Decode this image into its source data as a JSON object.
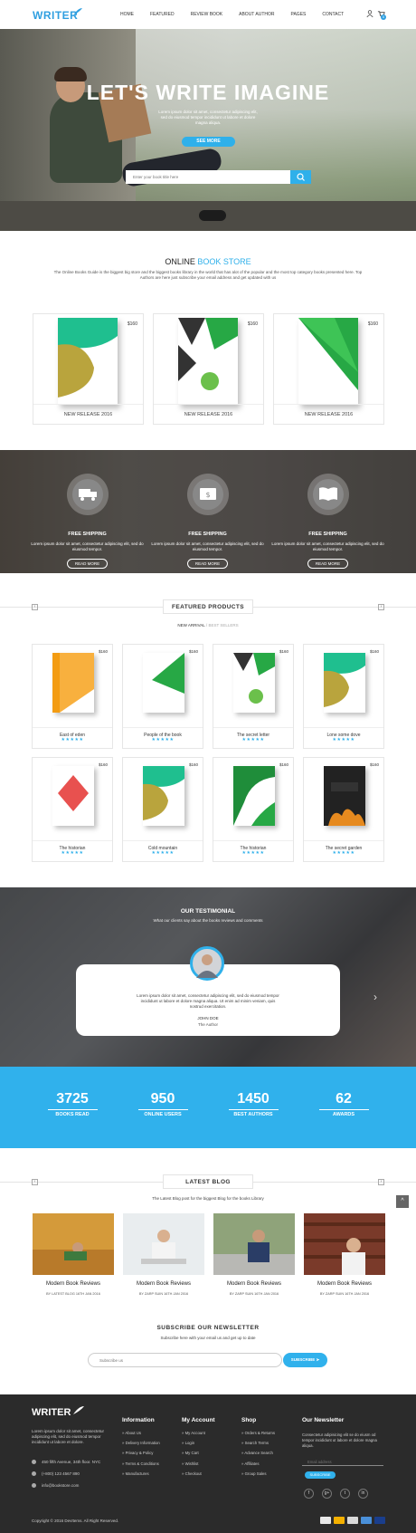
{
  "header": {
    "logo": "WRITER",
    "nav": [
      "HOME",
      "FEATURED",
      "REVIEW BOOK",
      "ABOUT AUTHOR",
      "PAGES",
      "CONTACT"
    ],
    "cart_count": "0"
  },
  "hero": {
    "title": "LET'S WRITE IMAGINE",
    "subtitle": "Lorem ipsum dolor sit amet, consectetur adipiscing elit, sed do eiusmod tempor incididunt ut labore et dolore magna aliqua.",
    "button": "SEE MORE",
    "search_placeholder": "Enter your book title here"
  },
  "online_store": {
    "title_a": "ONLINE ",
    "title_b": "BOOK STORE",
    "desc": "The Online Books Guide is the biggest big store and the biggest books library in the world that has alot of the popular and the most top category books presented here. Top Authors are here just subscribe your email address and get updated with us",
    "cards": [
      {
        "price": "$160",
        "label": "NEW RELEASE 2016"
      },
      {
        "price": "$160",
        "label": "NEW RELEASE 2016"
      },
      {
        "price": "$160",
        "label": "NEW RELEASE 2016"
      }
    ]
  },
  "features": [
    {
      "title": "FREE SHIPPING",
      "desc": "Lorem ipsum dolor sit amet, consectetur adipiscing elit, sed do eiusmod tempor.",
      "button": "READ MORE",
      "icon": "truck-icon"
    },
    {
      "title": "FREE SHIPPING",
      "desc": "Lorem ipsum dolor sit amet, consectetur adipiscing elit, sed do eiusmod tempor.",
      "button": "READ MORE",
      "icon": "money-icon"
    },
    {
      "title": "FREE SHIPPING",
      "desc": "Lorem ipsum dolor sit amet, consectetur adipiscing elit, sed do eiusmod tempor.",
      "button": "READ MORE",
      "icon": "book-icon"
    }
  ],
  "featured_products": {
    "title": "FEATURED PRODUCTS",
    "tab_active": "NEW ARRIVAL",
    "tab_sep": "/",
    "tab_other": "BEST SELLERS",
    "items": [
      {
        "price": "$160",
        "name": "East of eden",
        "stars": "★★★★★"
      },
      {
        "price": "$160",
        "name": "People of the book",
        "stars": "★★★★★"
      },
      {
        "price": "$160",
        "name": "The secret letter",
        "stars": "★★★★★"
      },
      {
        "price": "$160",
        "name": "Lone some dove",
        "stars": "★★★★★"
      },
      {
        "price": "$160",
        "name": "The historian",
        "stars": "★★★★★"
      },
      {
        "price": "$160",
        "name": "Cold mountain",
        "stars": "★★★★★"
      },
      {
        "price": "$160",
        "name": "The historian",
        "stars": "★★★★★"
      },
      {
        "price": "$160",
        "name": "The secret garden",
        "stars": "★★★★★"
      }
    ]
  },
  "testimonial": {
    "title": "OUR TESTIMONIAL",
    "subtitle": "What our clients say about the books reviews and comments",
    "text": "Lorem ipsum dolor sit amet, consectetur adipiscing elit, sed do eiusmod tempor incididunt ut labore et dolore magna aliqua. Ut enim ad minim veniam, quis nostrud exercitation.",
    "name": "JOHN DOE",
    "role": "The Author"
  },
  "stats": [
    {
      "number": "3725",
      "label": "BOOKS READ"
    },
    {
      "number": "950",
      "label": "ONLINE USERS"
    },
    {
      "number": "1450",
      "label": "BEST AUTHORS"
    },
    {
      "number": "62",
      "label": "AWARDS"
    }
  ],
  "blog": {
    "title": "LATEST BLOG",
    "subtitle": "The Latest Blog post for the biggest Blog for the books Library",
    "posts": [
      {
        "title": "Modern Book Reviews",
        "meta": "BY LATEST BLOG    16TH JAN 2016"
      },
      {
        "title": "Modern Book Reviews",
        "meta": "BY ZARP SUIN    16TH JAN 2016"
      },
      {
        "title": "Modern Book Reviews",
        "meta": "BY ZARP SUIN    16TH JAN 2016"
      },
      {
        "title": "Modern Book Reviews",
        "meta": "BY ZARP SUIN    16TH JAN 2016"
      }
    ]
  },
  "newsletter": {
    "title": "SUBSCRIBE OUR NEWSLETTER",
    "subtitle": "Subscribe here with your email us and get up to date",
    "placeholder": "Subscribe us",
    "button": "SUBSCRIBE"
  },
  "footer": {
    "logo": "WRITER",
    "about": "Lorem ipsum dolor sit amet, consectetur adipiscing elit, sed do eiusmod tempor incididunt ut labore et dolore.",
    "address": "450 fifth Avenue, 34th floor. NYC",
    "phone": "(+800) 123 4567 890",
    "email": "info@bookstore.com",
    "columns": [
      {
        "heading": "Information",
        "items": [
          "About Us",
          "Delivery Information",
          "Privacy & Policy",
          "Terms & Conditions",
          "Manufactures"
        ]
      },
      {
        "heading": "My Account",
        "items": [
          "My Account",
          "Login",
          "My Cart",
          "Wishlist",
          "Checkout"
        ]
      },
      {
        "heading": "Shop",
        "items": [
          "Orders & Returns",
          "Search Terms",
          "Advance Search",
          "Affiliates",
          "Group Sales"
        ]
      }
    ],
    "newsletter_heading": "Our Newsletter",
    "newsletter_text": "Consectetur adipisicing elit se do eiusm od tempor incididunt ut labore et dolore magna aliqua.",
    "email_placeholder": "Email address",
    "subscribe_button": "SUBSCRIBE",
    "copyright": "Copyright © 2016 DevItems. All Right Reserved.",
    "social": [
      "f",
      "g+",
      "t",
      "in"
    ]
  }
}
